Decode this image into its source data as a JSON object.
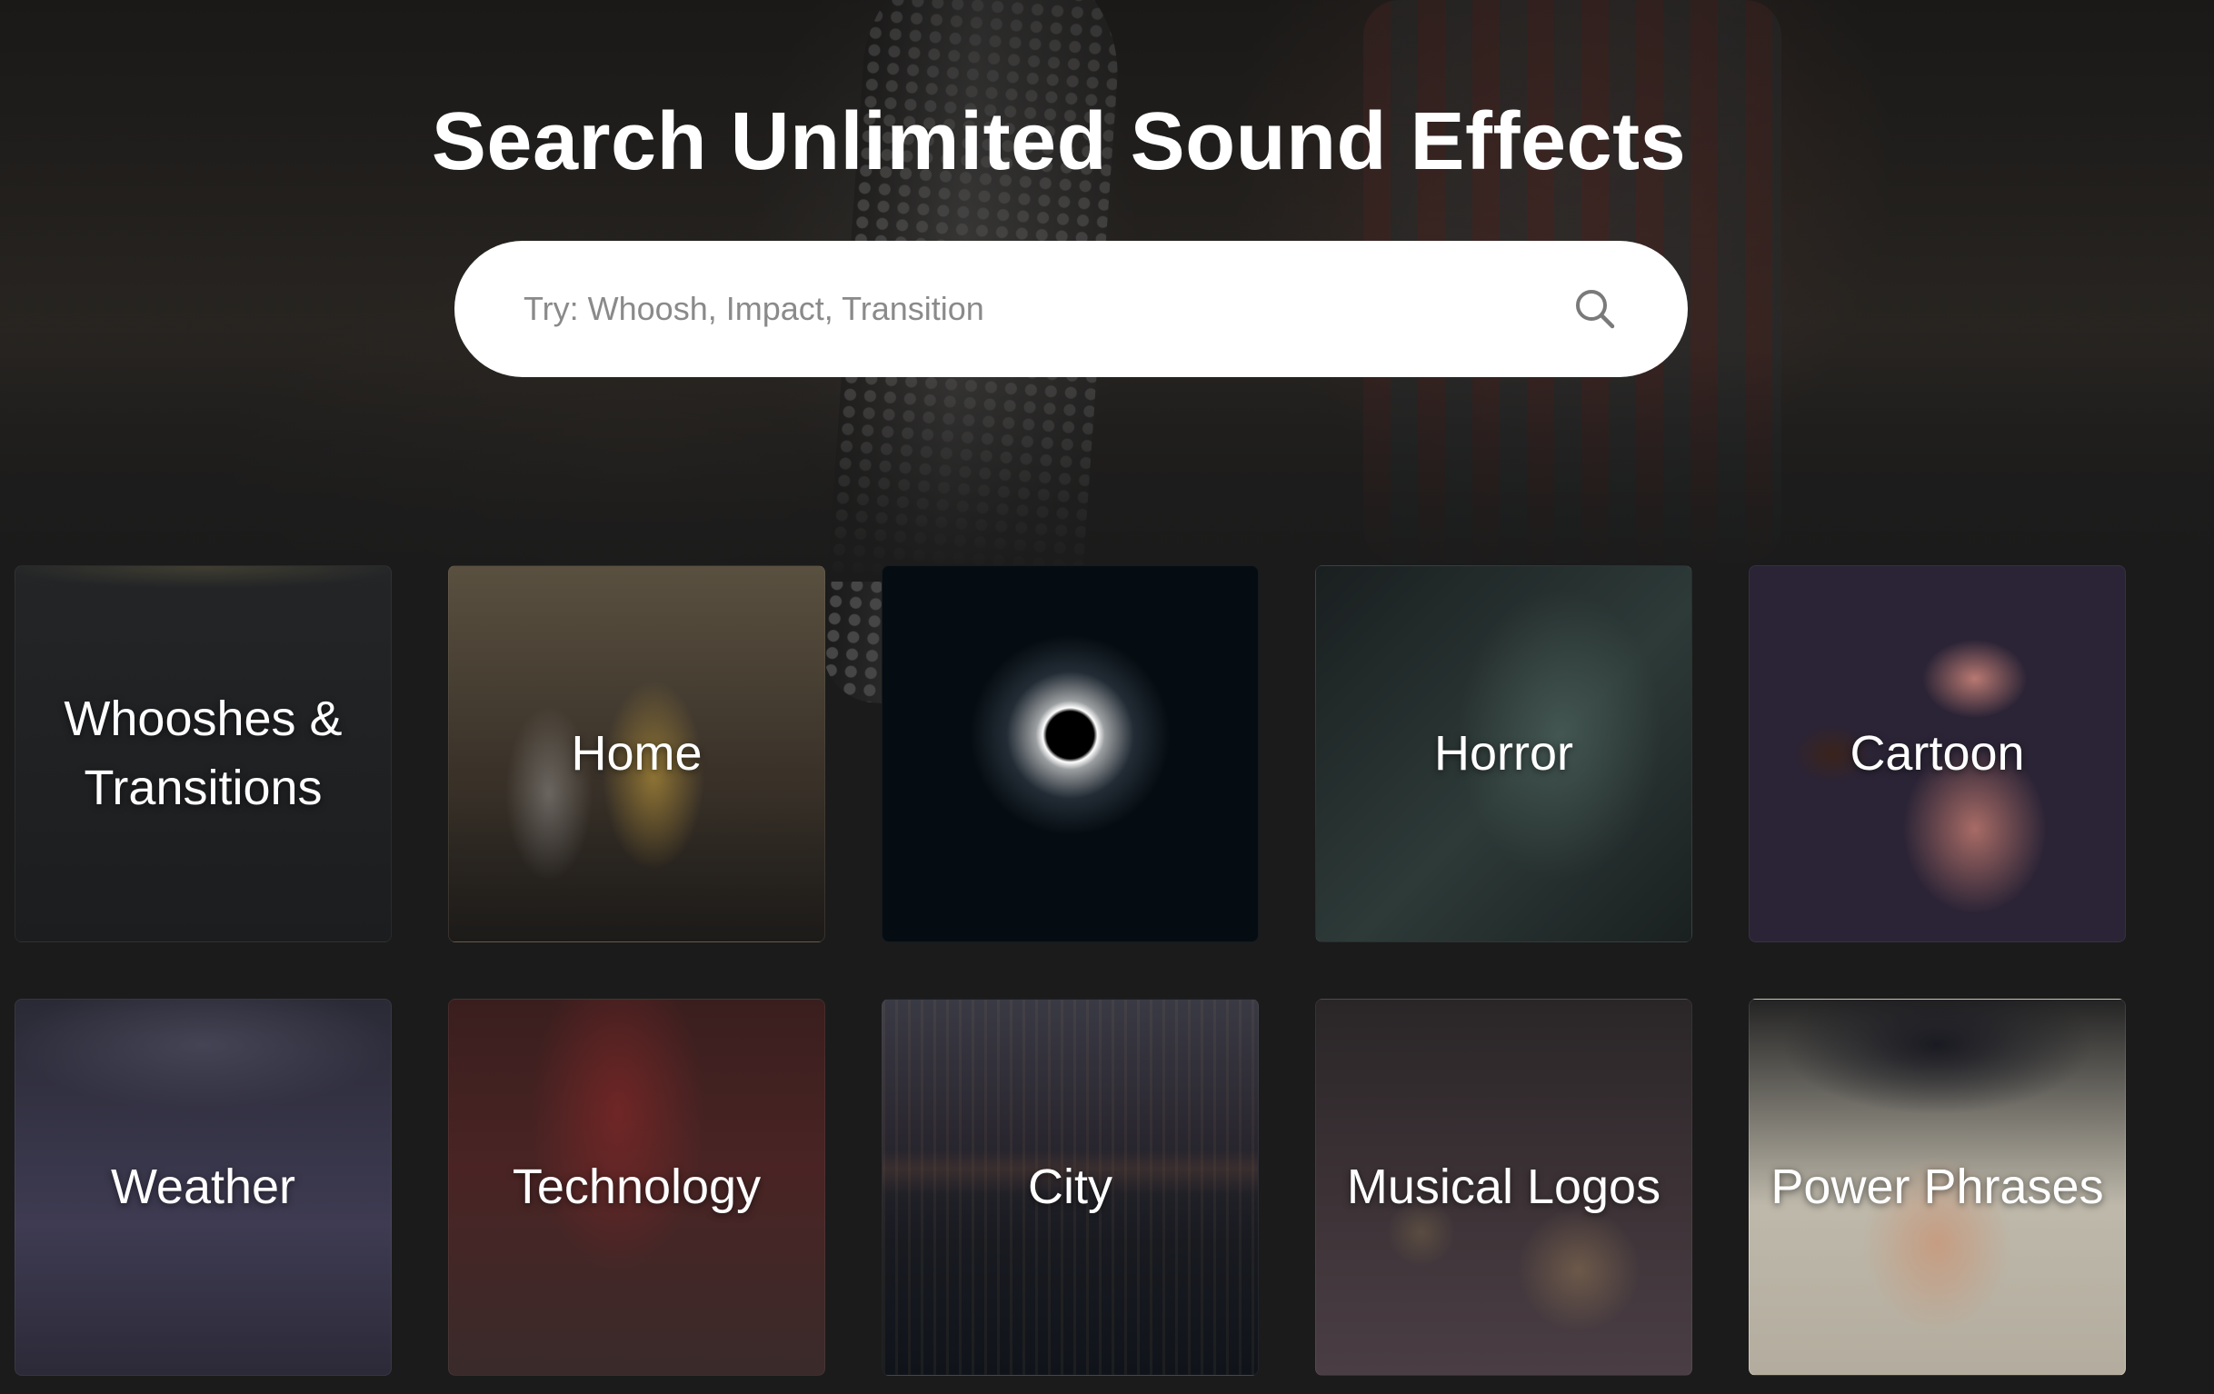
{
  "hero": {
    "title": "Search Unlimited Sound Effects",
    "search_placeholder": "Try: Whoosh, Impact, Transition"
  },
  "categories": [
    {
      "label": "Whooshes &\nTransitions"
    },
    {
      "label": "Home"
    },
    {
      "label": ""
    },
    {
      "label": "Horror"
    },
    {
      "label": "Cartoon"
    },
    {
      "label": "Weather"
    },
    {
      "label": "Technology"
    },
    {
      "label": "City"
    },
    {
      "label": "Musical Logos"
    },
    {
      "label": "Power Phrases"
    }
  ],
  "icons": {
    "search": "search-icon"
  },
  "colors": {
    "background": "#1b1b1b",
    "search_bg": "#ffffff",
    "text": "#ffffff",
    "placeholder": "#8a8a8a"
  }
}
